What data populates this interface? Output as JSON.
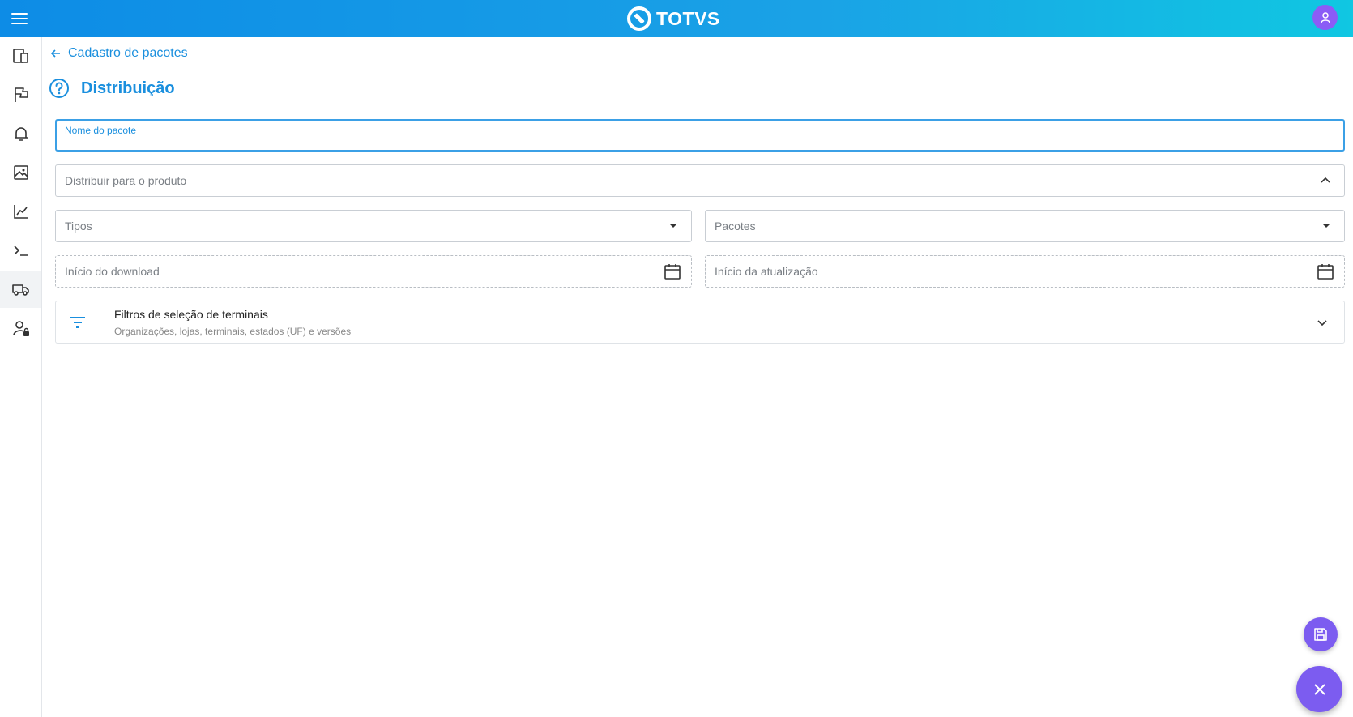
{
  "header": {
    "logo_text": "TOTVS"
  },
  "sidebar": {
    "items": [
      {
        "name": "devices-icon"
      },
      {
        "name": "flag-icon"
      },
      {
        "name": "bell-icon"
      },
      {
        "name": "image-icon"
      },
      {
        "name": "chart-line-icon"
      },
      {
        "name": "terminal-icon"
      },
      {
        "name": "truck-icon",
        "active": true
      },
      {
        "name": "user-lock-icon"
      }
    ]
  },
  "breadcrumb": {
    "back_label": "Cadastro de pacotes"
  },
  "page": {
    "title": "Distribuição"
  },
  "form": {
    "package_name": {
      "label": "Nome do pacote",
      "value": ""
    },
    "product": {
      "placeholder": "Distribuir para o produto"
    },
    "types": {
      "placeholder": "Tipos"
    },
    "packages": {
      "placeholder": "Pacotes"
    },
    "download_start": {
      "placeholder": "Início do download"
    },
    "update_start": {
      "placeholder": "Início da atualização"
    }
  },
  "filters": {
    "title": "Filtros de seleção de terminais",
    "subtitle": "Organizações, lojas, terminais, estados (UF) e versões"
  },
  "colors": {
    "primary": "#1a8fde",
    "fab": "#7c5cf0",
    "avatar": "#8b5cf6"
  }
}
